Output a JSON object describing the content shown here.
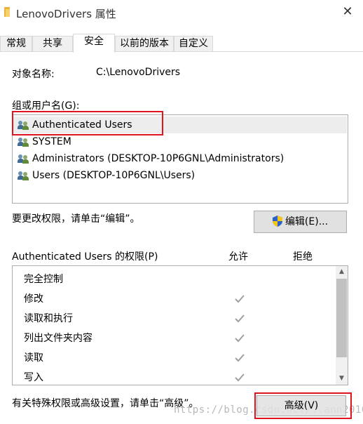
{
  "window": {
    "title": "LenovoDrivers 属性",
    "close_glyph": "✕"
  },
  "tabs": [
    {
      "label": "常规"
    },
    {
      "label": "共享"
    },
    {
      "label": "安全"
    },
    {
      "label": "以前的版本"
    },
    {
      "label": "自定义"
    }
  ],
  "active_tab": "安全",
  "object": {
    "label": "对象名称:",
    "value": "C:\\LenovoDrivers"
  },
  "groups": {
    "label": "组或用户名(G):",
    "items": [
      {
        "name": "Authenticated Users",
        "icon": "users-icon"
      },
      {
        "name": "SYSTEM",
        "icon": "users-icon"
      },
      {
        "name": "Administrators (DESKTOP-10P6GNL\\Administrators)",
        "icon": "users-icon"
      },
      {
        "name": "Users (DESKTOP-10P6GNL\\Users)",
        "icon": "users-icon"
      }
    ],
    "selected_index": 0
  },
  "edit": {
    "hint": "要更改权限，请单击“编辑”。",
    "button_label": "编辑(E)...",
    "icon": "shield-icon"
  },
  "permissions": {
    "header": "Authenticated Users 的权限(P)",
    "allow_label": "允许",
    "deny_label": "拒绝",
    "rows": [
      {
        "name": "完全控制",
        "allow": false,
        "deny": false
      },
      {
        "name": "修改",
        "allow": true,
        "deny": false
      },
      {
        "name": "读取和执行",
        "allow": true,
        "deny": false
      },
      {
        "name": "列出文件夹内容",
        "allow": true,
        "deny": false
      },
      {
        "name": "读取",
        "allow": true,
        "deny": false
      },
      {
        "name": "写入",
        "allow": true,
        "deny": false
      }
    ]
  },
  "advanced": {
    "hint": "有关特殊权限或高级设置，请单击“高级”。",
    "button_label": "高级(V)"
  },
  "watermark": "https://blog.csdn.net/..ann2016",
  "colors": {
    "highlight_red": "#e0141e",
    "selection_bg": "#ededed",
    "check_gray": "#a0a0a0"
  }
}
